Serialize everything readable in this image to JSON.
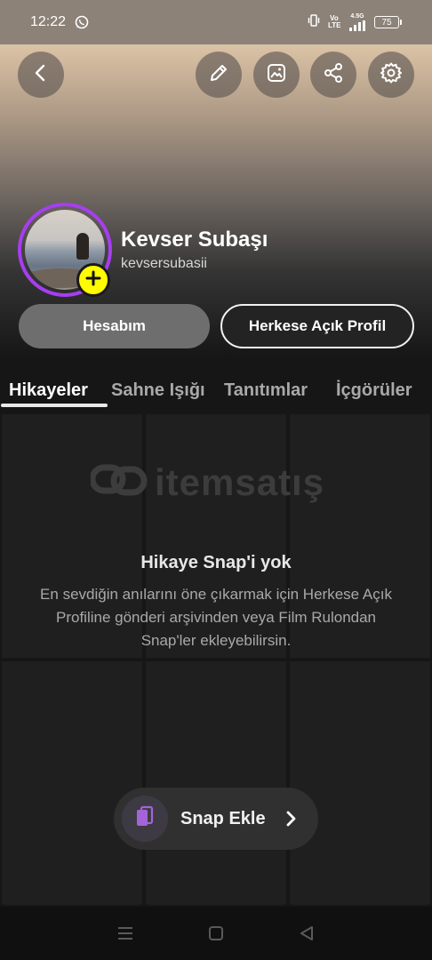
{
  "status_bar": {
    "time": "12:22",
    "volte_label": "Vo LTE",
    "network_label": "4.5G",
    "battery_level": "75"
  },
  "header": {
    "back_icon": "chevron-left-icon",
    "actions": [
      "pencil-icon",
      "image-icon",
      "share-icon",
      "gear-icon"
    ]
  },
  "profile": {
    "display_name": "Kevser Subaşı",
    "username": "kevsersubasii",
    "ring_color": "#a63ef0",
    "add_story_color": "#fffc00"
  },
  "buttons": {
    "account": "Hesabım",
    "public_profile": "Herkese Açık Profil"
  },
  "tabs": [
    {
      "label": "Hikayeler",
      "active": true
    },
    {
      "label": "Sahne Işığı",
      "active": false
    },
    {
      "label": "Tanıtımlar",
      "active": false
    },
    {
      "label": "İçgörüler",
      "active": false
    }
  ],
  "watermark": {
    "text": "itemsatış"
  },
  "empty_state": {
    "title": "Hikaye Snap'i yok",
    "description": "En sevdiğin anılarını öne çıkarmak için Herkese Açık Profiline gönderi arşivinden veya Film Rulondan Snap'ler ekleyebilirsin."
  },
  "add_snap": {
    "label": "Snap Ekle",
    "icon": "pages-icon",
    "icon_color": "#a463d8"
  },
  "nav": [
    "menu-icon",
    "home-icon",
    "back-icon"
  ]
}
